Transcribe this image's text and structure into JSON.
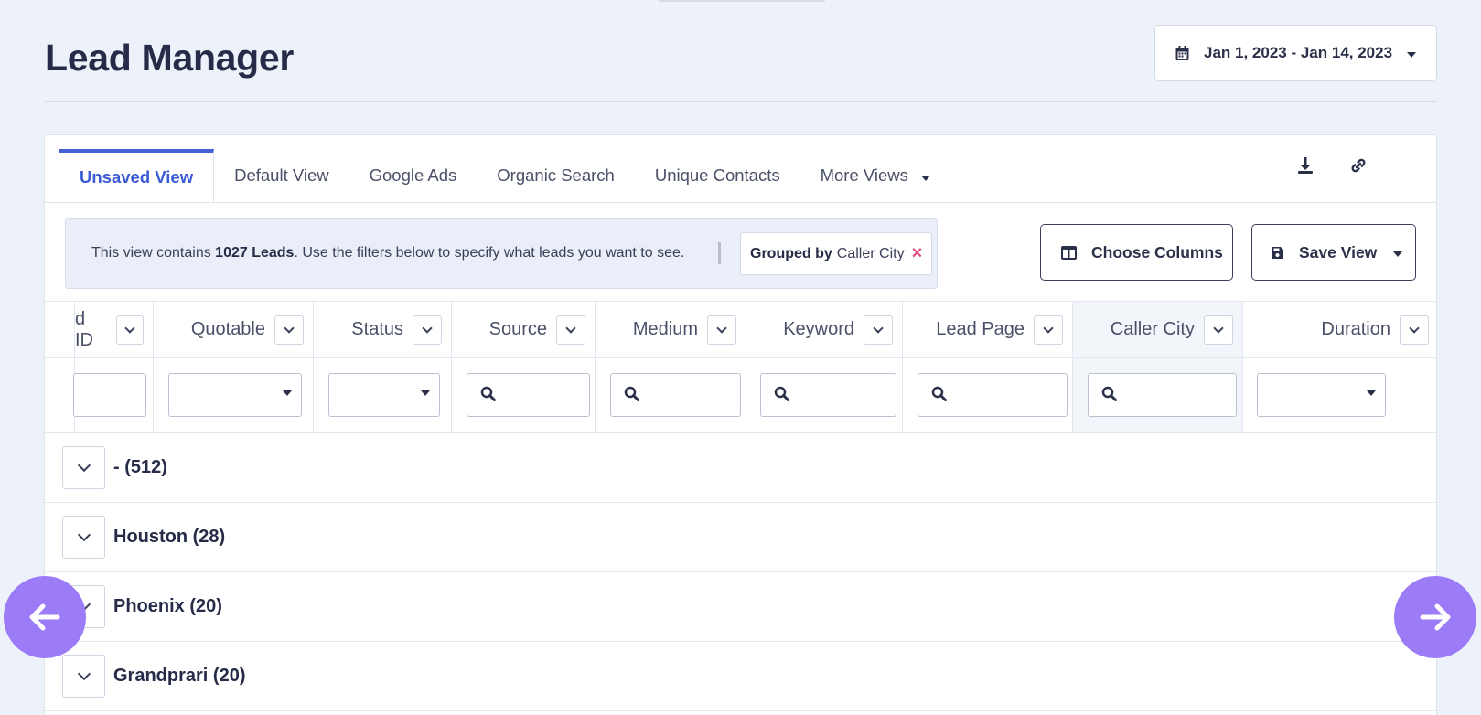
{
  "header": {
    "title": "Lead Manager",
    "date_range": "Jan 1, 2023 - Jan 14, 2023"
  },
  "tabs": [
    {
      "label": "Unsaved View",
      "active": true
    },
    {
      "label": "Default View",
      "active": false
    },
    {
      "label": "Google Ads",
      "active": false
    },
    {
      "label": "Organic Search",
      "active": false
    },
    {
      "label": "Unique Contacts",
      "active": false
    },
    {
      "label": "More Views",
      "active": false
    }
  ],
  "toolbar_icons": [
    "download-icon",
    "link-icon"
  ],
  "info": {
    "prefix": "This view contains ",
    "count": "1027 Leads",
    "suffix": ". Use the filters below to specify what leads you want to see.",
    "grouped_by_label": "Grouped by",
    "grouped_by_value": "Caller City",
    "remove_symbol": "×"
  },
  "buttons": {
    "choose_columns": "Choose Columns",
    "save_view": "Save View"
  },
  "columns": [
    {
      "label": "d ID",
      "filter": "text"
    },
    {
      "label": "Quotable",
      "filter": "select"
    },
    {
      "label": "Status",
      "filter": "select"
    },
    {
      "label": "Source",
      "filter": "search"
    },
    {
      "label": "Medium",
      "filter": "search"
    },
    {
      "label": "Keyword",
      "filter": "search"
    },
    {
      "label": "Lead Page",
      "filter": "search"
    },
    {
      "label": "Caller City",
      "filter": "search",
      "highlighted": true
    },
    {
      "label": "Duration",
      "filter": "select"
    }
  ],
  "groups": [
    {
      "label": "- (512)"
    },
    {
      "label": "Houston (28)"
    },
    {
      "label": "Phoenix (20)"
    },
    {
      "label": "Grandprari (20)"
    }
  ],
  "colors": {
    "accent": "#4560d6",
    "nav_button": "#9b7cf6",
    "remove_x": "#e24d7d",
    "background": "#edf1f9"
  }
}
